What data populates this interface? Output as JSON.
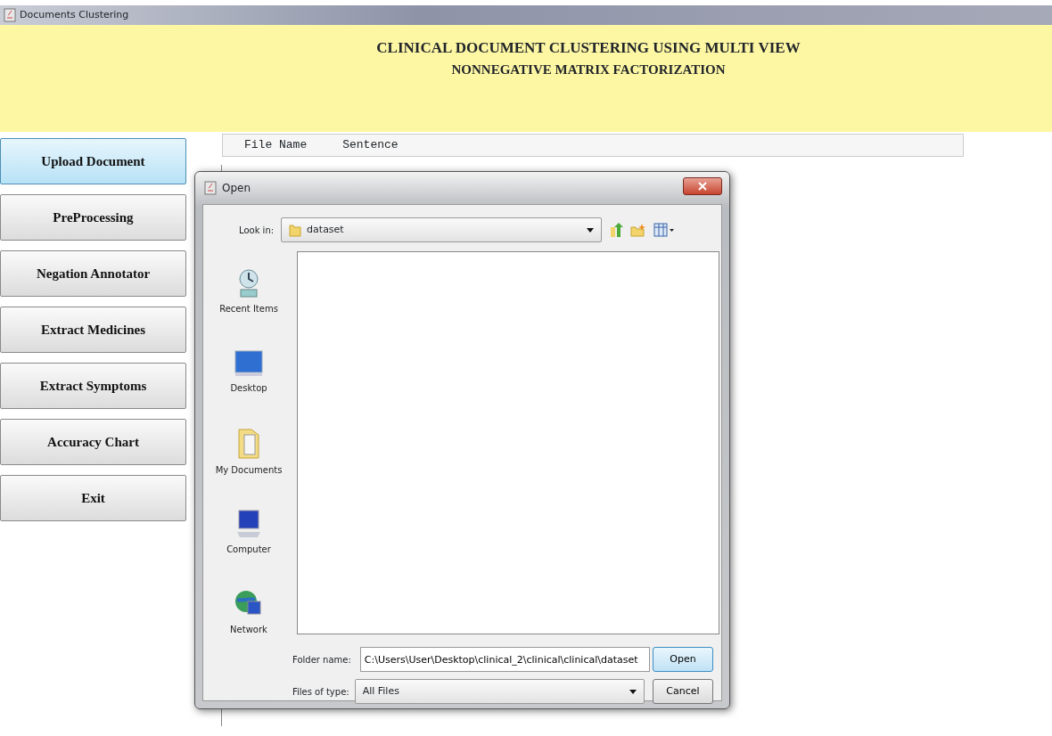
{
  "window": {
    "title": "Documents Clustering"
  },
  "header": {
    "lines": [
      "CLINICAL DOCUMENT CLUSTERING USING MULTI VIEW",
      "NONNEGATIVE MATRIX FACTORIZATION"
    ]
  },
  "sidebar": {
    "items": [
      {
        "label": "Upload Document",
        "selected": true
      },
      {
        "label": "PreProcessing",
        "selected": false
      },
      {
        "label": "Negation Annotator",
        "selected": false
      },
      {
        "label": "Extract Medicines",
        "selected": false
      },
      {
        "label": "Extract Symptoms",
        "selected": false
      },
      {
        "label": "Accuracy Chart",
        "selected": false
      },
      {
        "label": "Exit",
        "selected": false
      }
    ]
  },
  "table": {
    "columns": [
      "File Name",
      "Sentence"
    ]
  },
  "dialog": {
    "title": "Open",
    "look_in": {
      "label": "Look in:",
      "value": "dataset"
    },
    "places": [
      {
        "label": "Recent Items",
        "kind": "recent"
      },
      {
        "label": "Desktop",
        "kind": "desktop"
      },
      {
        "label": "My Documents",
        "kind": "documents"
      },
      {
        "label": "Computer",
        "kind": "computer"
      },
      {
        "label": "Network",
        "kind": "network"
      }
    ],
    "folder_name": {
      "label": "Folder name:",
      "value": "C:\\Users\\User\\Desktop\\clinical_2\\clinical\\clinical\\dataset"
    },
    "file_type": {
      "label": "Files of type:",
      "value": "All Files"
    },
    "buttons": [
      {
        "label": "Open",
        "focused": true
      },
      {
        "label": "Cancel",
        "focused": false
      }
    ]
  }
}
